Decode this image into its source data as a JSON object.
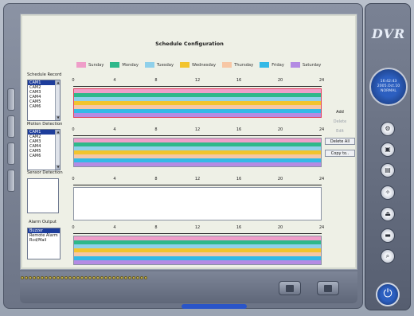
{
  "title": "Schedule Configuration",
  "legend": [
    {
      "label": "Sunday",
      "color": "#ef9ec9"
    },
    {
      "label": "Monday",
      "color": "#2eb88a"
    },
    {
      "label": "Tuesday",
      "color": "#8fd0ea"
    },
    {
      "label": "Wednesday",
      "color": "#f2c42e"
    },
    {
      "label": "Thursday",
      "color": "#f7c7a5"
    },
    {
      "label": "Friday",
      "color": "#34b9e6"
    },
    {
      "label": "Saturday",
      "color": "#b48be3"
    }
  ],
  "hour_ticks": [
    "0",
    "4",
    "8",
    "12",
    "16",
    "20",
    "24"
  ],
  "sections": {
    "schedule_record": {
      "label": "Schedule Record",
      "items": [
        "CAM1",
        "CAM2",
        "CAM3",
        "CAM4",
        "CAM5",
        "CAM6"
      ],
      "selected": 0
    },
    "motion_detection": {
      "label": "Motion Detection",
      "items": [
        "CAM1",
        "CAM2",
        "CAM3",
        "CAM4",
        "CAM5",
        "CAM6"
      ],
      "selected": 0
    },
    "sensor_detection": {
      "label": "Sensor Detection",
      "items": []
    },
    "alarm_output": {
      "label": "Alarm Output",
      "items": [
        "Buzzer",
        "Remote Alarm",
        "Rcd/Mail"
      ],
      "selected": 0
    }
  },
  "side_buttons": {
    "add": "Add",
    "delete": "Delete",
    "edit": "Edit",
    "delete_all": "Delete All",
    "copy_to": "Copy to.."
  },
  "clock": {
    "time": "16:42:43",
    "date": "2005.Oct.10",
    "status": "NORMAL"
  },
  "logo": "DVR"
}
